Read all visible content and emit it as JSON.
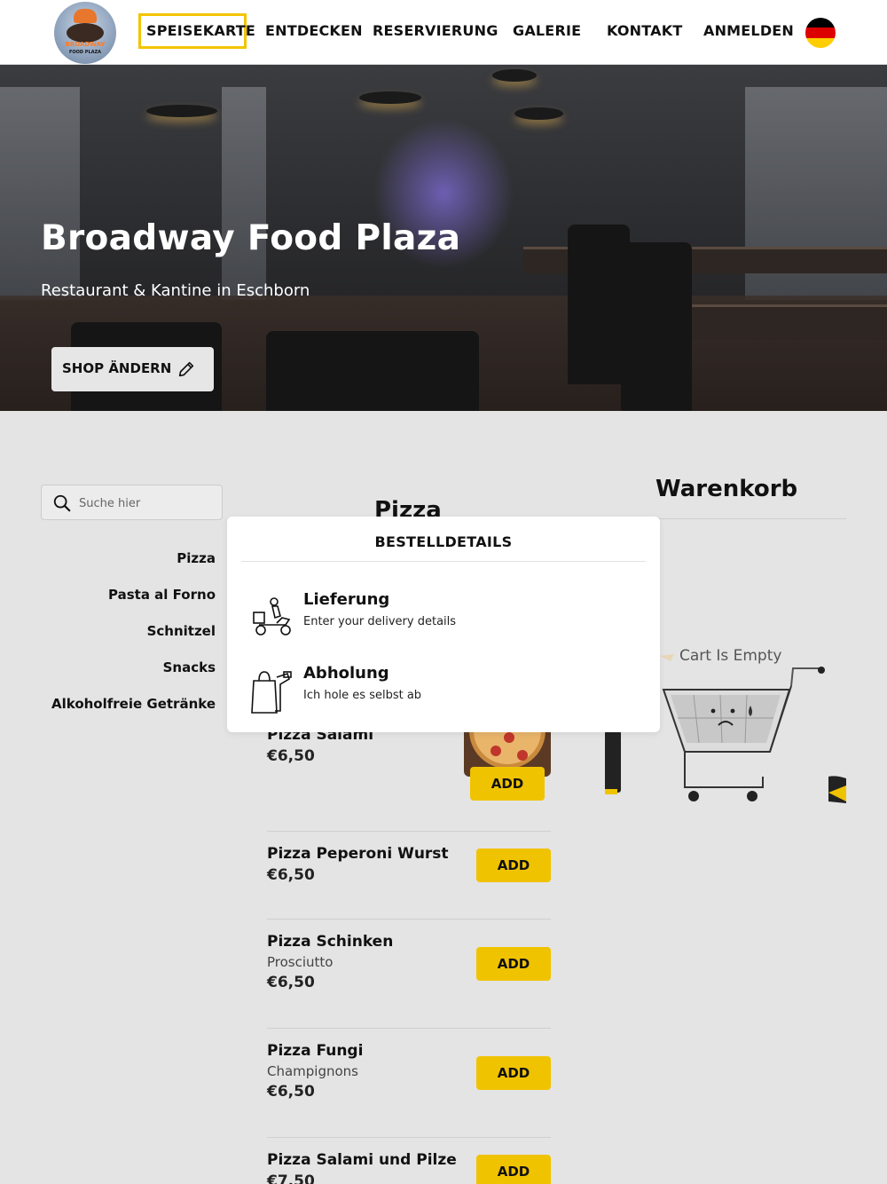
{
  "logo": {
    "brand": "BROADWAY",
    "sub": "FOOD PLAZA"
  },
  "nav": {
    "items": [
      "SPEISEKARTE",
      "ENTDECKEN",
      "RESERVIERUNG",
      "GALERIE",
      "KONTAKT",
      "ANMELDEN"
    ],
    "active": "SPEISEKARTE",
    "language_icon": "germany-flag-icon"
  },
  "hero": {
    "title": "Broadway Food Plaza",
    "subtitle": "Restaurant & Kantine in Eschborn",
    "shop_button": "SHOP ÄNDERN"
  },
  "search": {
    "placeholder": "Suche hier"
  },
  "categories": [
    "Pizza",
    "Pasta al Forno",
    "Schnitzel",
    "Snacks",
    "Alkoholfreie Getränke"
  ],
  "menu": {
    "section_title": "Pizza",
    "add_label": "ADD",
    "items": [
      {
        "name": "Pizza Salami",
        "price": "€6,50"
      },
      {
        "name": "Pizza Peperoni Wurst",
        "price": "€6,50"
      },
      {
        "name": "Pizza Schinken",
        "description": "Prosciutto",
        "price": "€6,50"
      },
      {
        "name": "Pizza Fungi",
        "description": "Champignons",
        "price": "€6,50"
      },
      {
        "name": "Pizza Salami und Pilze",
        "price": "€7,50"
      }
    ]
  },
  "cart": {
    "title": "Warenkorb",
    "empty_text": "Cart Is Empty"
  },
  "modal": {
    "title": "BESTELLDETAILS",
    "options": [
      {
        "title": "Lieferung",
        "subtitle": "Enter your delivery details",
        "icon": "delivery-scooter-icon"
      },
      {
        "title": "Abholung",
        "subtitle": "Ich hole es selbst ab",
        "icon": "takeaway-bag-icon"
      }
    ]
  },
  "colors": {
    "accent": "#f0c300",
    "page_bg": "#e4e4e4"
  }
}
